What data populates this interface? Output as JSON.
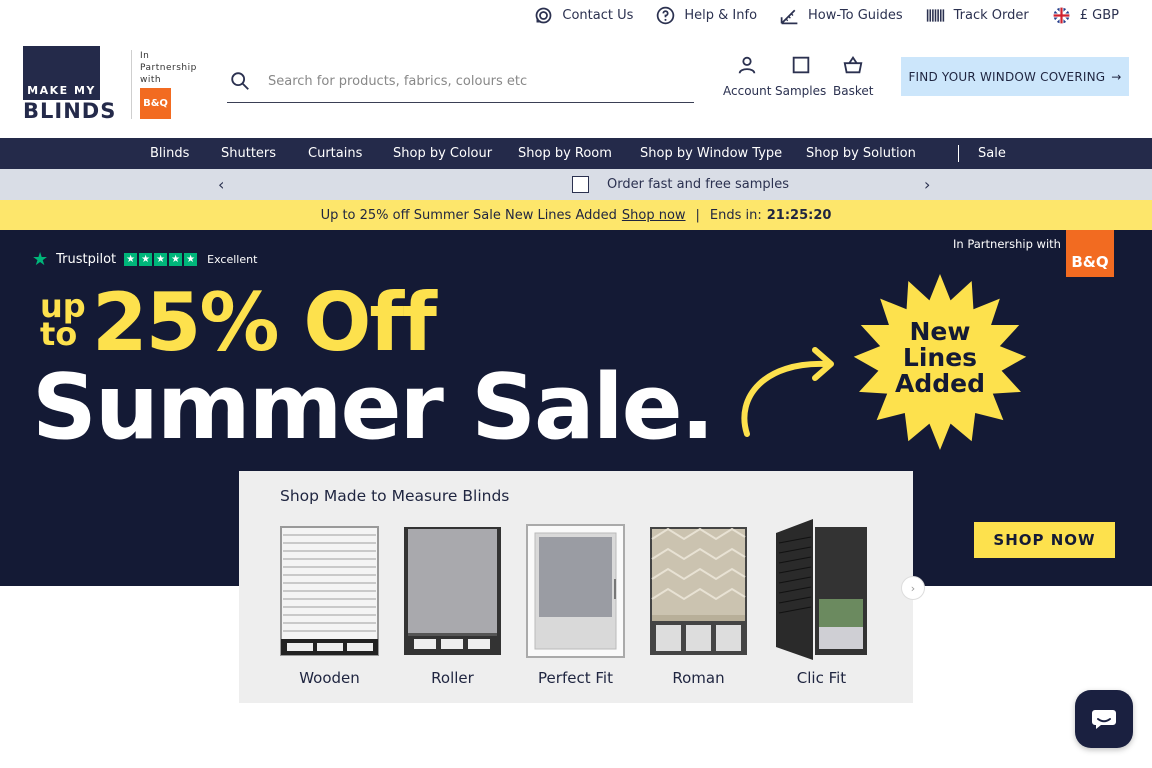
{
  "utility": {
    "contact": "Contact Us",
    "help": "Help & Info",
    "guides": "How-To Guides",
    "track": "Track Order",
    "currency": "£ GBP"
  },
  "logo": {
    "line1": "MAKE MY",
    "line2": "BLINDS"
  },
  "partnership": {
    "line1": "In",
    "line2": "Partnership",
    "line3": "with",
    "brand": "B&Q"
  },
  "search": {
    "placeholder": "Search for products, fabrics, colours etc"
  },
  "header_icons": {
    "account": "Account",
    "samples": "Samples",
    "basket": "Basket"
  },
  "find_button": "FIND YOUR WINDOW COVERING",
  "nav": [
    "Blinds",
    "Shutters",
    "Curtains",
    "Shop by Colour",
    "Shop by Room",
    "Shop by Window Type",
    "Shop by Solution",
    "Sale"
  ],
  "strip": {
    "text": "Order fast and free samples"
  },
  "sale_bar": {
    "text": "Up to 25% off Summer Sale New Lines Added",
    "link": "Shop now",
    "separator": "|",
    "ends": "Ends in:",
    "timer": "21:25:20"
  },
  "hero": {
    "trustpilot": "Trustpilot",
    "rating": "Excellent",
    "partner": "In Partnership with",
    "partner_brand": "B&Q",
    "upto_1": "up",
    "upto_2": "to",
    "percent": "25% Off",
    "headline": "Summer Sale.",
    "burst_1": "New",
    "burst_2": "Lines",
    "burst_3": "Added",
    "cta": "SHOP NOW",
    "colors": {
      "navy": "#141a35",
      "yellow": "#fde14d"
    }
  },
  "panel": {
    "title": "Shop Made to Measure Blinds",
    "items": [
      "Wooden",
      "Roller",
      "Perfect Fit",
      "Roman",
      "Clic Fit"
    ]
  }
}
